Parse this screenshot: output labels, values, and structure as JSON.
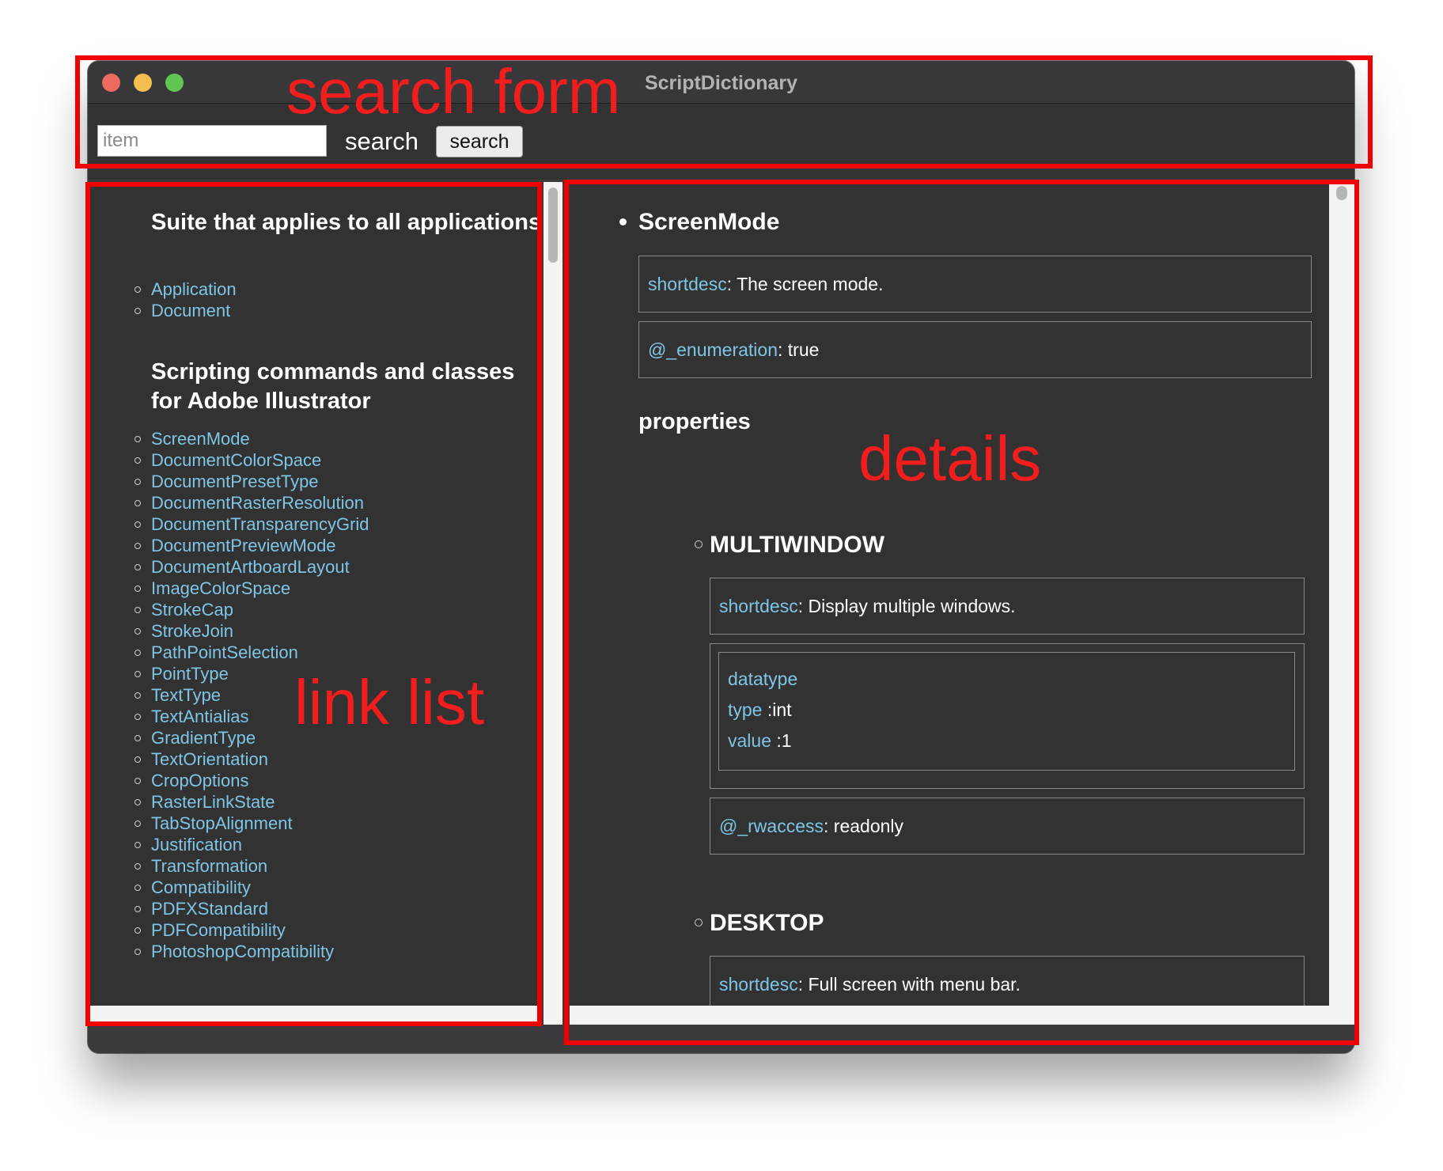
{
  "window": {
    "title": "ScriptDictionary"
  },
  "search": {
    "placeholder": "item",
    "label": "search",
    "button_label": "search"
  },
  "sidebar": {
    "groups": [
      {
        "title": "Suite that applies to all applications",
        "items": [
          "Application",
          "Document"
        ]
      },
      {
        "title": "Scripting commands and classes for Adobe Illustrator",
        "items": [
          "ScreenMode",
          "DocumentColorSpace",
          "DocumentPresetType",
          "DocumentRasterResolution",
          "DocumentTransparencyGrid",
          "DocumentPreviewMode",
          "DocumentArtboardLayout",
          "ImageColorSpace",
          "StrokeCap",
          "StrokeJoin",
          "PathPointSelection",
          "PointType",
          "TextType",
          "TextAntialias",
          "GradientType",
          "TextOrientation",
          "CropOptions",
          "RasterLinkState",
          "TabStopAlignment",
          "Justification",
          "Transformation",
          "Compatibility",
          "PDFXStandard",
          "PDFCompatibility",
          "PhotoshopCompatibility"
        ]
      }
    ]
  },
  "details": {
    "title": "ScreenMode",
    "entries": [
      {
        "key": "shortdesc",
        "value": ": The screen mode."
      },
      {
        "key": "@_enumeration",
        "value": ": true"
      }
    ],
    "properties_heading": "properties",
    "properties": [
      {
        "name": "MULTIWINDOW",
        "shortdesc_key": "shortdesc",
        "shortdesc_value": ": Display multiple windows.",
        "datatype_label": "datatype",
        "type_key": "type",
        "type_value": " :int",
        "value_key": "value",
        "value_value": " :1",
        "rwaccess_key": "@_rwaccess",
        "rwaccess_value": ": readonly"
      },
      {
        "name": "DESKTOP",
        "shortdesc_key": "shortdesc",
        "shortdesc_value": ": Full screen with menu bar."
      }
    ]
  },
  "annotations": {
    "search_form": "search form",
    "link_list": "link list",
    "details": "details"
  }
}
